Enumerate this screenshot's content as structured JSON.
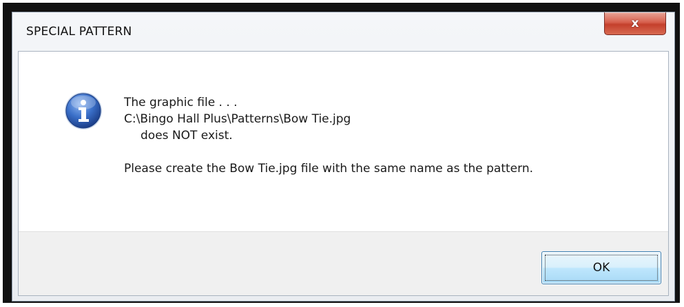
{
  "window": {
    "title": "SPECIAL PATTERN",
    "close_label": "x"
  },
  "icon": {
    "name": "information-icon",
    "glyph": "i",
    "color": "#2b5fb4"
  },
  "message": {
    "line1": "The graphic file . . .",
    "line2": "C:\\Bingo Hall Plus\\Patterns\\Bow Tie.jpg",
    "line3": "does NOT exist.",
    "line4": "Please create the Bow Tie.jpg file with the same name as the pattern."
  },
  "buttons": {
    "ok_label": "OK"
  }
}
